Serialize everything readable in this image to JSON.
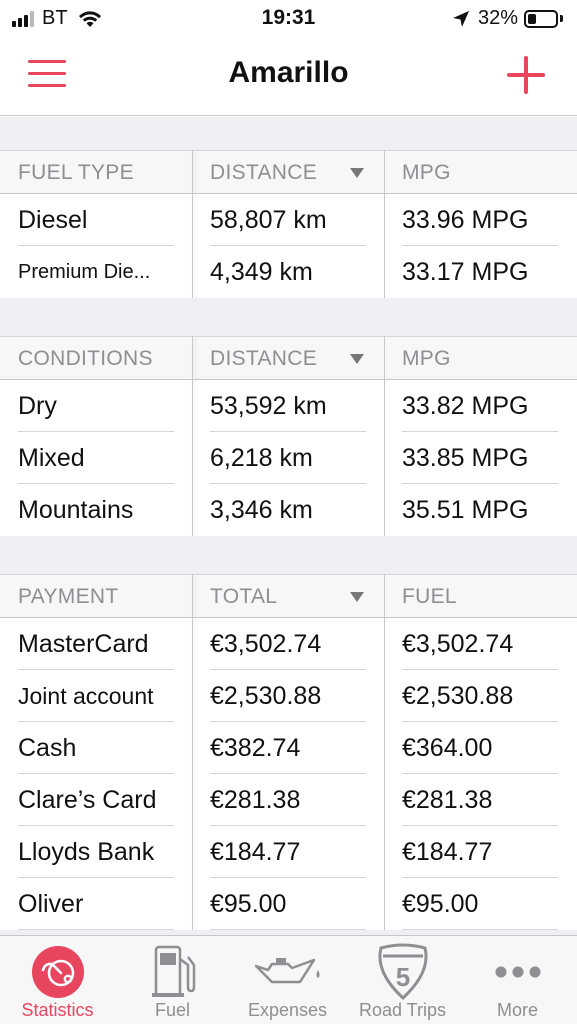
{
  "status_bar": {
    "carrier": "BT",
    "time": "19:31",
    "battery_percent": "32%",
    "battery_level": 0.32
  },
  "nav": {
    "title": "Amarillo"
  },
  "fuel_type_table": {
    "headers": [
      "FUEL TYPE",
      "DISTANCE",
      "MPG"
    ],
    "rows": [
      {
        "name": "Diesel",
        "distance": "58,807 km",
        "mpg": "33.96 MPG"
      },
      {
        "name": "Premium Die...",
        "distance": "4,349 km",
        "mpg": "33.17 MPG"
      }
    ]
  },
  "conditions_table": {
    "headers": [
      "CONDITIONS",
      "DISTANCE",
      "MPG"
    ],
    "rows": [
      {
        "name": "Dry",
        "distance": "53,592 km",
        "mpg": "33.82 MPG"
      },
      {
        "name": "Mixed",
        "distance": "6,218 km",
        "mpg": "33.85 MPG"
      },
      {
        "name": "Mountains",
        "distance": "3,346 km",
        "mpg": "35.51 MPG"
      }
    ]
  },
  "payment_table": {
    "headers": [
      "PAYMENT",
      "TOTAL",
      "FUEL"
    ],
    "rows": [
      {
        "name": "MasterCard",
        "total": "€3,502.74",
        "fuel": "€3,502.74"
      },
      {
        "name": "Joint account",
        "total": "€2,530.88",
        "fuel": "€2,530.88"
      },
      {
        "name": "Cash",
        "total": "€382.74",
        "fuel": "€364.00"
      },
      {
        "name": "Clare’s Card",
        "total": "€281.38",
        "fuel": "€281.38"
      },
      {
        "name": "Lloyds Bank",
        "total": "€184.77",
        "fuel": "€184.77"
      },
      {
        "name": "Oliver",
        "total": "€95.00",
        "fuel": "€95.00"
      }
    ]
  },
  "tabbar": {
    "tabs": [
      {
        "label": "Statistics",
        "icon": "statistics-icon",
        "active": true
      },
      {
        "label": "Fuel",
        "icon": "fuel-pump-icon",
        "active": false
      },
      {
        "label": "Expenses",
        "icon": "oil-can-icon",
        "active": false
      },
      {
        "label": "Road Trips",
        "icon": "highway-shield-icon",
        "active": false,
        "badge": "5"
      },
      {
        "label": "More",
        "icon": "more-dots-icon",
        "active": false
      }
    ]
  },
  "colors": {
    "accent": "#e8455e",
    "header_text": "#8e8e93",
    "background": "#efeff4"
  }
}
